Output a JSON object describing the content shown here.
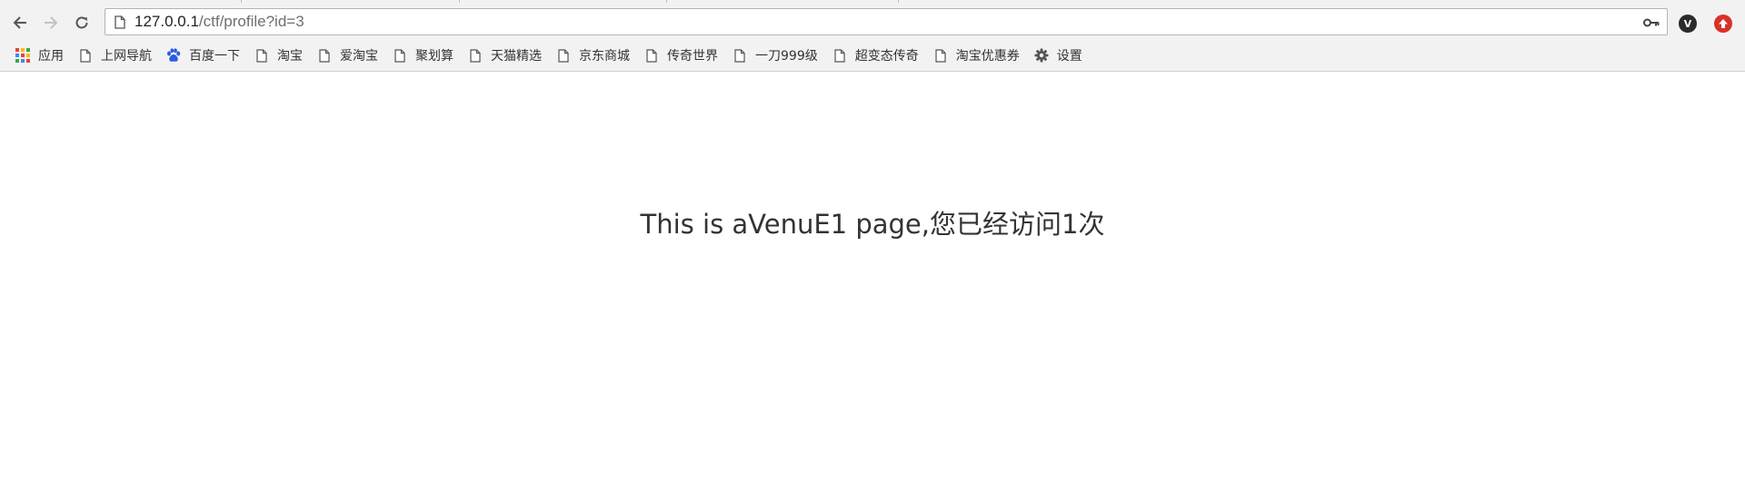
{
  "browser": {
    "address_bar": {
      "host": "127.0.0.1",
      "path": "/ctf/profile?id=3"
    },
    "icons": {
      "back": "back-arrow-icon",
      "forward": "forward-arrow-icon",
      "reload": "reload-icon",
      "page": "page-icon",
      "key": "key-icon"
    },
    "extensions": [
      {
        "name": "v-extension-icon",
        "glyph": "V",
        "color": "#2b2b2b"
      },
      {
        "name": "red-extension-icon",
        "color": "#d9312a"
      }
    ]
  },
  "bookmarks": [
    {
      "label": "应用",
      "icon": "apps-grid-icon"
    },
    {
      "label": "上网导航",
      "icon": "page-icon"
    },
    {
      "label": "百度一下",
      "icon": "baidu-paw-icon"
    },
    {
      "label": "淘宝",
      "icon": "page-icon"
    },
    {
      "label": "爱淘宝",
      "icon": "page-icon"
    },
    {
      "label": "聚划算",
      "icon": "page-icon"
    },
    {
      "label": "天猫精选",
      "icon": "page-icon"
    },
    {
      "label": "京东商城",
      "icon": "page-icon"
    },
    {
      "label": "传奇世界",
      "icon": "page-icon"
    },
    {
      "label": "一刀999级",
      "icon": "page-icon"
    },
    {
      "label": "超变态传奇",
      "icon": "page-icon"
    },
    {
      "label": "淘宝优惠券",
      "icon": "page-icon"
    },
    {
      "label": "设置",
      "icon": "gear-icon"
    }
  ],
  "page": {
    "heading": "This is aVenuE1 page,您已经访问1次"
  }
}
